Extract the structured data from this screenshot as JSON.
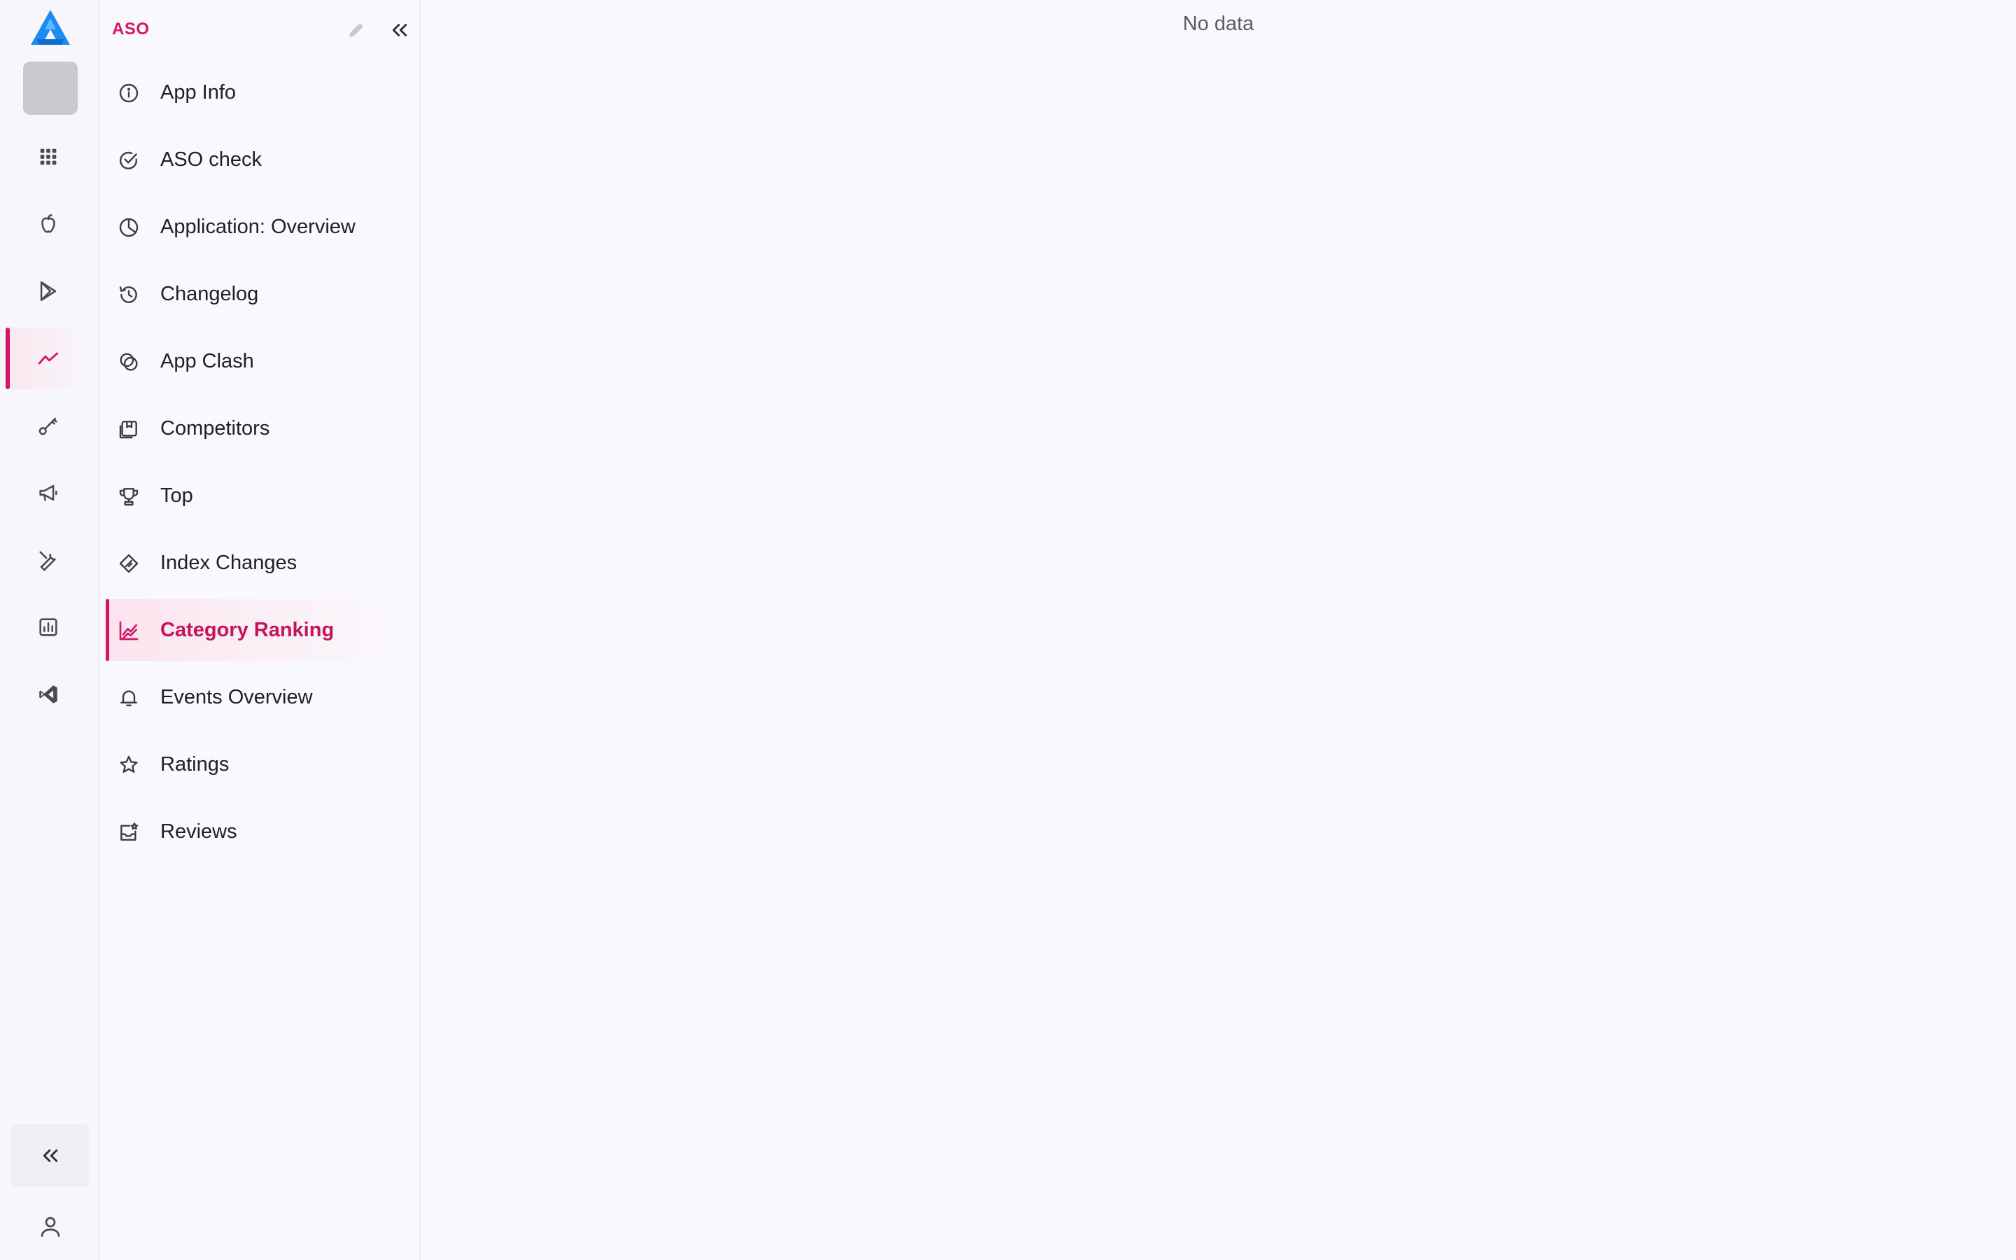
{
  "brand": {
    "accent": "#d4166a",
    "logo_blue": "#1d8cf0"
  },
  "rail": {
    "items": [
      {
        "name": "apps-grid-icon",
        "active": false
      },
      {
        "name": "apple-icon",
        "active": false
      },
      {
        "name": "google-play-icon",
        "active": false
      },
      {
        "name": "trending-chart-icon",
        "active": true
      },
      {
        "name": "key-icon",
        "active": false
      },
      {
        "name": "megaphone-icon",
        "active": false
      },
      {
        "name": "tools-icon",
        "active": false
      },
      {
        "name": "bar-chart-icon",
        "active": false
      },
      {
        "name": "integration-icon",
        "active": false
      }
    ],
    "collapse_icon": "double-chevron-left-icon",
    "user_icon": "user-icon"
  },
  "sidebar": {
    "title": "ASO",
    "items": [
      {
        "label": "App Info",
        "icon": "info-icon"
      },
      {
        "label": "ASO check",
        "icon": "check-circle-icon"
      },
      {
        "label": "Application: Overview",
        "icon": "pie-chart-icon"
      },
      {
        "label": "Changelog",
        "icon": "history-icon"
      },
      {
        "label": "App Clash",
        "icon": "clash-icon"
      },
      {
        "label": "Competitors",
        "icon": "competitors-icon"
      },
      {
        "label": "Top",
        "icon": "trophy-icon"
      },
      {
        "label": "Index Changes",
        "icon": "index-icon"
      },
      {
        "label": "Category Ranking",
        "icon": "line-chart-icon",
        "active": true
      },
      {
        "label": "Events Overview",
        "icon": "bell-icon"
      },
      {
        "label": "Ratings",
        "icon": "star-icon"
      },
      {
        "label": "Reviews",
        "icon": "reviews-icon"
      }
    ]
  },
  "main": {
    "empty_text": "No data"
  }
}
